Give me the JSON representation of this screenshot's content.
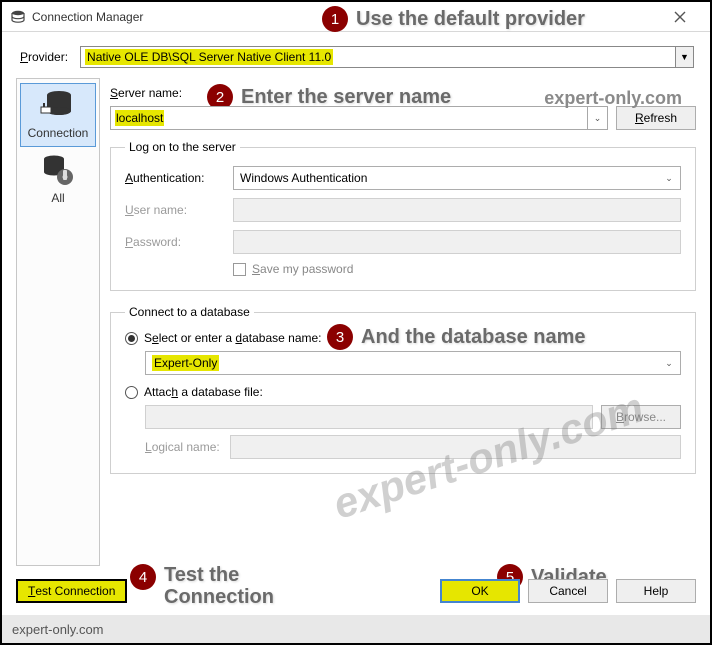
{
  "window": {
    "title": "Connection Manager"
  },
  "annotations": {
    "a1": "Use the default provider",
    "a2": "Enter the server name",
    "a3": "And the database name",
    "a4": "Test the",
    "a4b": "Connection",
    "a5": "Validate"
  },
  "watermark": "expert-only.com",
  "provider": {
    "label": "Provider:",
    "value": "Native OLE DB\\SQL Server Native Client 11.0"
  },
  "sidebar": {
    "items": [
      {
        "label": "Connection"
      },
      {
        "label": "All"
      }
    ]
  },
  "server": {
    "label": "Server name:",
    "value": "localhost",
    "refresh": "Refresh"
  },
  "logon": {
    "legend": "Log on to the server",
    "auth_label": "Authentication:",
    "auth_value": "Windows Authentication",
    "user_label": "User name:",
    "pass_label": "Password:",
    "save_pw": "Save my password"
  },
  "db": {
    "legend": "Connect to a database",
    "select_label": "Select or enter a database name:",
    "select_value": "Expert-Only",
    "attach_label": "Attach a database file:",
    "browse": "Browse...",
    "logical_label": "Logical name:"
  },
  "buttons": {
    "test": "Test Connection",
    "ok": "OK",
    "cancel": "Cancel",
    "help": "Help"
  },
  "footer": "expert-only.com"
}
